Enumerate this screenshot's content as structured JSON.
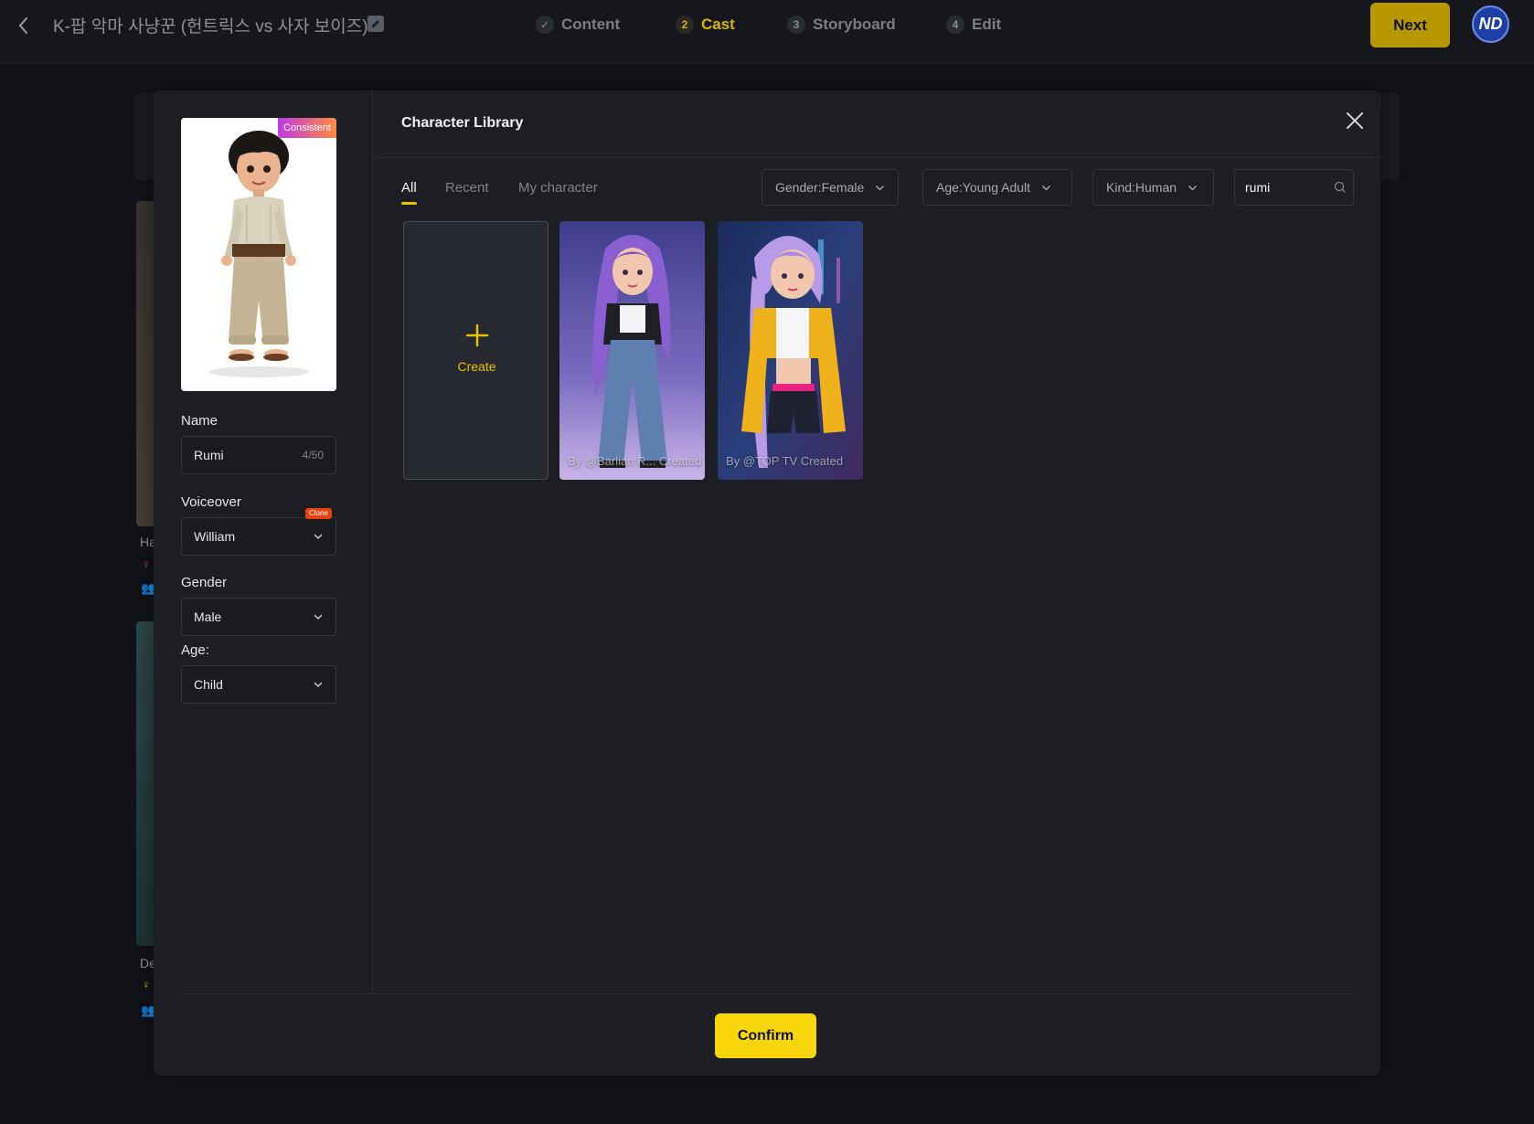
{
  "header": {
    "project_title": "K-팝 악마 사냥꾼 (헌트릭스 vs 사자 보이즈)",
    "steps": [
      {
        "num": "✓",
        "label": "Content"
      },
      {
        "num": "2",
        "label": "Cast"
      },
      {
        "num": "3",
        "label": "Storyboard"
      },
      {
        "num": "4",
        "label": "Edit"
      }
    ],
    "active_step": "Cast",
    "next_label": "Next",
    "avatar_initials": "ND"
  },
  "background": {
    "card1_label": "Ha",
    "card2_label": "De"
  },
  "modal": {
    "title": "Character Library",
    "left": {
      "badge": "Consistent",
      "name_label": "Name",
      "name_value": "Rumi",
      "name_count": "4/50",
      "voiceover_label": "Voiceover",
      "voiceover_value": "William",
      "clone_badge": "Clone",
      "gender_label": "Gender",
      "gender_value": "Male",
      "age_label": "Age:",
      "age_value": "Child"
    },
    "tabs": [
      "All",
      "Recent",
      "My character"
    ],
    "active_tab": "All",
    "filters": {
      "gender": "Gender:Female",
      "age": "Age:Young Adult",
      "kind": "Kind:Human"
    },
    "search_value": "rumi",
    "create_label": "Create",
    "characters": [
      {
        "caption": "By @Barlian R...  Created"
      },
      {
        "caption": "By @TOP TV Created"
      }
    ],
    "confirm_label": "Confirm"
  },
  "colors": {
    "accent": "#F7D70B",
    "active_step": "#D7B400",
    "background": "#121319",
    "modal": "#1D1E24"
  }
}
